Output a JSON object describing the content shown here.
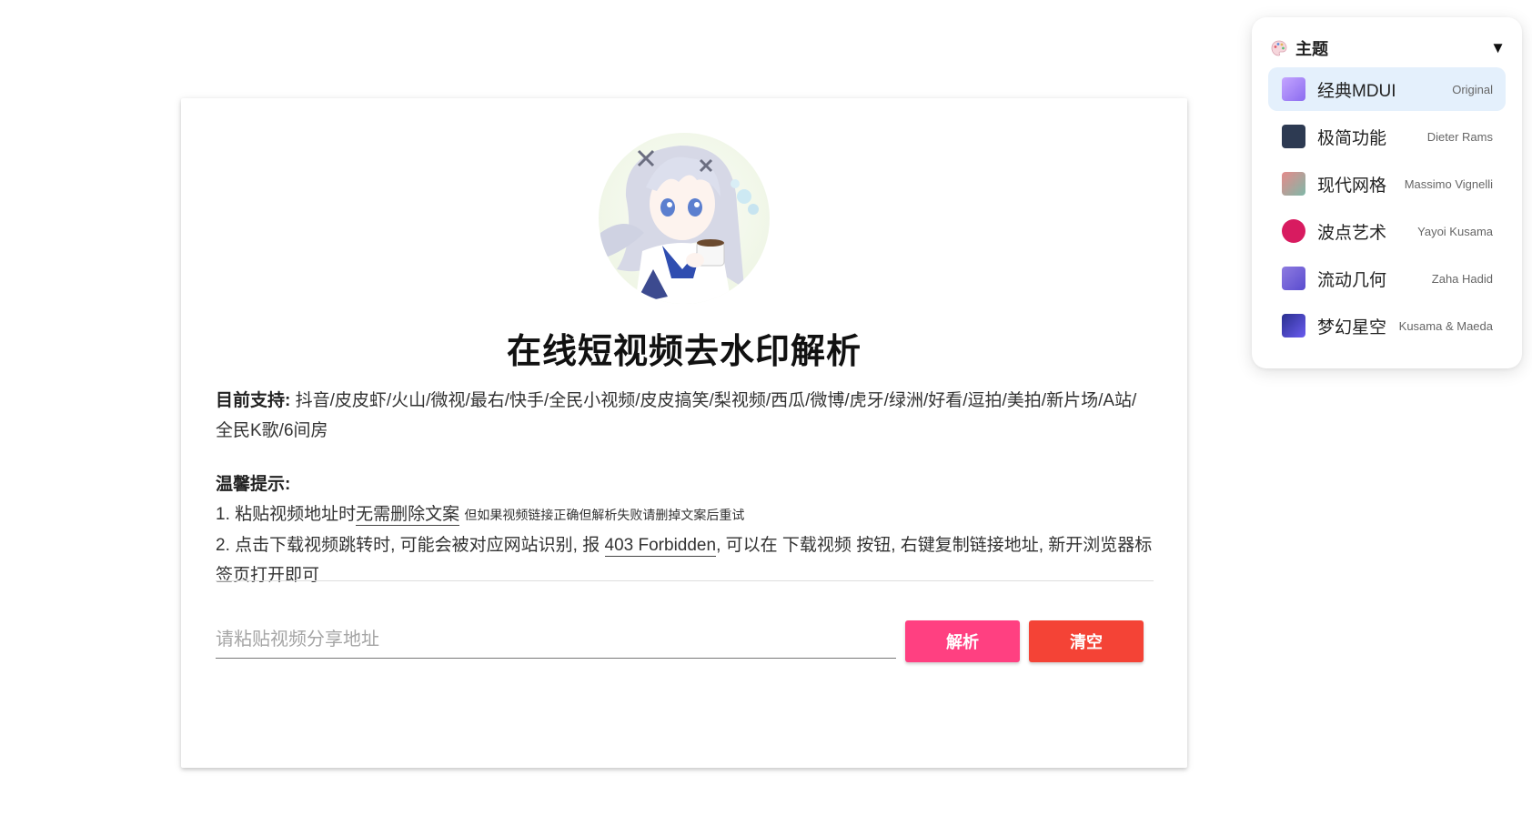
{
  "page": {
    "title": "在线短视频去水印解析",
    "support_label": "目前支持:",
    "support_list": "抖音/皮皮虾/火山/微视/最右/快手/全民小视频/皮皮搞笑/梨视频/西瓜/微博/虎牙/绿洲/好看/逗拍/美拍/新片场/A站/全民K歌/6间房",
    "tips_title": "温馨提示:",
    "tip1_prefix": "1. 粘贴视频地址时",
    "tip1_emphasis": "无需删除文案",
    "tip1_note": "但如果视频链接正确但解析失败请删掉文案后重试",
    "tip2_prefix": "2. 点击下载视频跳转时, 可能会被对应网站识别, 报",
    "tip2_emphasis": "403 Forbidden",
    "tip2_suffix": ", 可以在 下载视频 按钮, 右键复制链接地址, 新开浏览器标签页打开即可",
    "input_placeholder": "请粘贴视频分享地址",
    "input_value": "",
    "parse_button": "解析",
    "clear_button": "清空"
  },
  "theme_panel": {
    "label": "主题",
    "expanded": true,
    "icon": "palette-icon",
    "toggle_icon": "caret-down-icon",
    "items": [
      {
        "name": "经典MDUI",
        "author": "Original",
        "color": "#a78bfa",
        "active": true
      },
      {
        "name": "极简功能",
        "author": "Dieter Rams",
        "color": "#2d3a52",
        "active": false
      },
      {
        "name": "现代网格",
        "author": "Massimo Vignelli",
        "color": "#d98a8a",
        "active": false
      },
      {
        "name": "波点艺术",
        "author": "Yayoi Kusama",
        "color": "#d81b60",
        "active": false
      },
      {
        "name": "流动几何",
        "author": "Zaha Hadid",
        "color": "#6a5acd",
        "active": false
      },
      {
        "name": "梦幻星空",
        "author": "Kusama & Maeda",
        "color": "#4338ca",
        "active": false
      }
    ]
  },
  "colors": {
    "parse_button": "#ff4081",
    "clear_button": "#f44336",
    "active_theme_bg": "#e4f0fc"
  }
}
